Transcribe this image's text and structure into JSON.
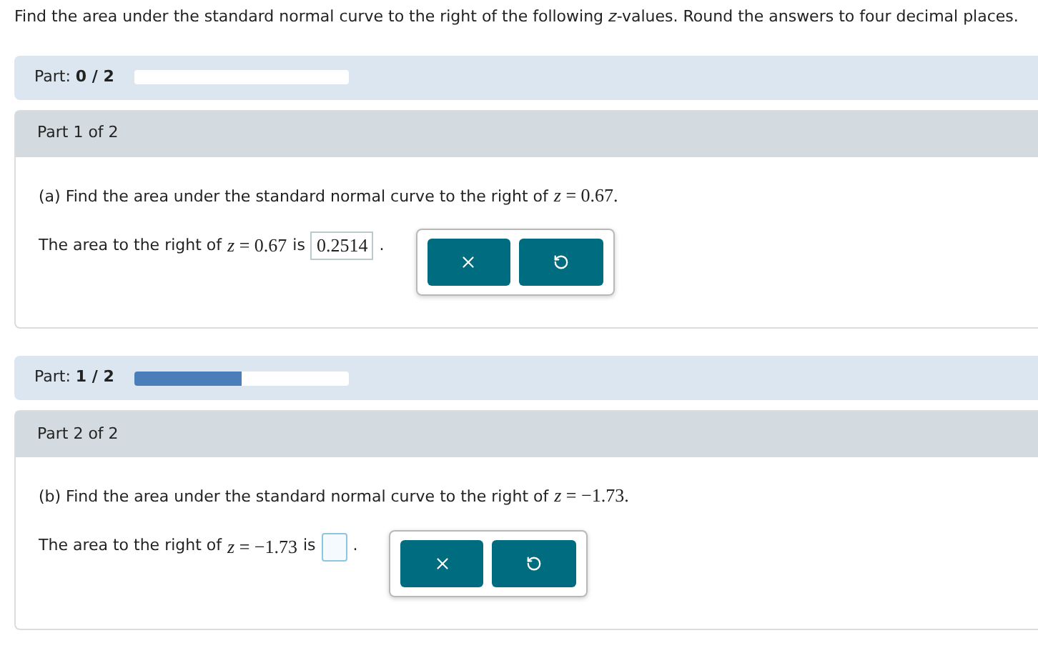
{
  "instructions": "Find the area under the standard normal curve to the right of the following *z*-values. Round the answers to four decimal places.",
  "parts": [
    {
      "progress": {
        "label": "Part:",
        "count": "0 / 2",
        "level": 0
      },
      "header": "Part 1 of 2",
      "question": "(a) Find the area under the standard normal curve to the right of",
      "question_equation": "*z* = 0.67.",
      "answer_lead": "The area to the right of",
      "answer_equation": "*z* = 0.67",
      "answer_is": "is",
      "answer_value": "0.2514",
      "answer_end": "."
    },
    {
      "progress": {
        "label": "Part:",
        "count": "1 / 2",
        "level": 0.5
      },
      "header": "Part 2 of 2",
      "question": "(b) Find the area under the standard normal curve to the right of",
      "question_equation": "*z* = −1.73.",
      "answer_lead": "The area to the right of",
      "answer_equation": "*z* = −1.73",
      "answer_is": "is",
      "answer_end": "."
    }
  ]
}
